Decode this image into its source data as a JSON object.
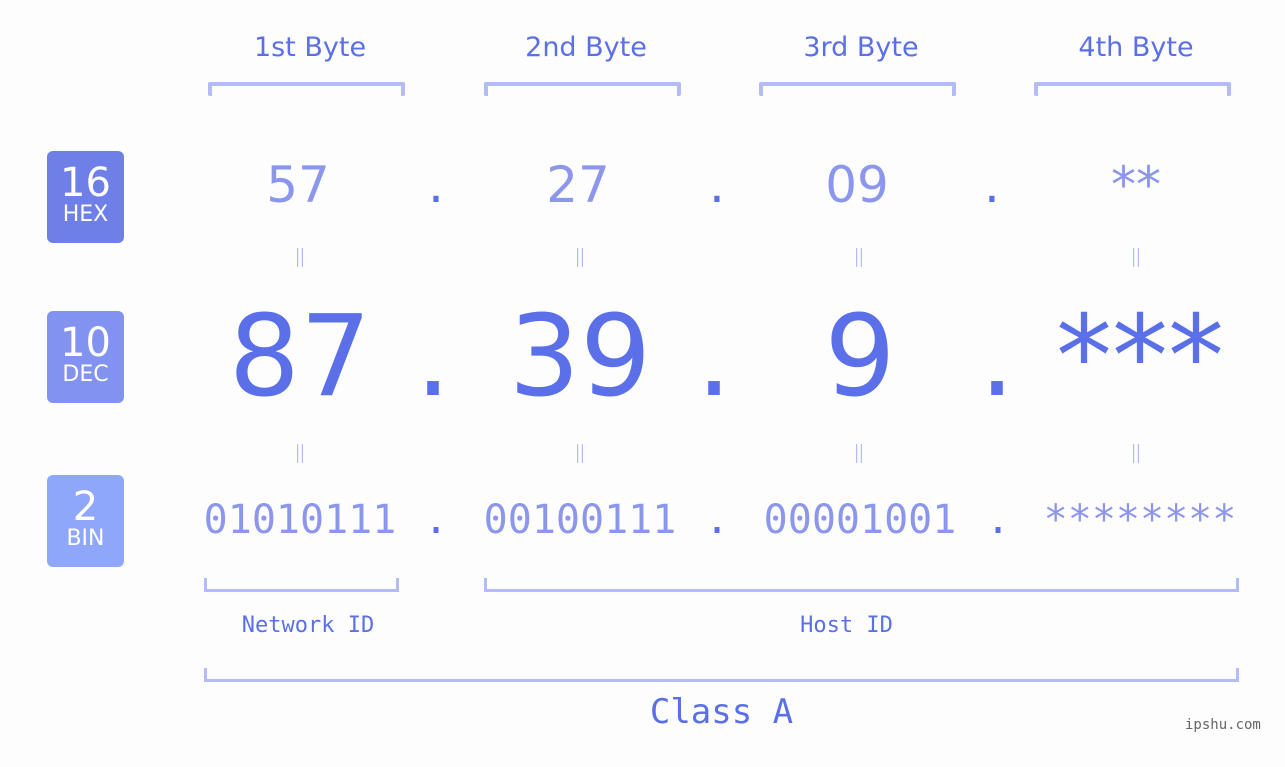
{
  "byte_headers": [
    "1st Byte",
    "2nd Byte",
    "3rd Byte",
    "4th Byte"
  ],
  "bases": [
    {
      "num": "16",
      "label": "HEX",
      "color": "#6e7fe8"
    },
    {
      "num": "10",
      "label": "DEC",
      "color": "#8292f1"
    },
    {
      "num": "2",
      "label": "BIN",
      "color": "#8fa7fb"
    }
  ],
  "hex": [
    "57",
    "27",
    "09",
    "**"
  ],
  "dec": [
    "87",
    "39",
    "9",
    "***"
  ],
  "bin": [
    "01010111",
    "00100111",
    "00001001",
    "********"
  ],
  "separator": ".",
  "equals": "=",
  "network_label": "Network ID",
  "host_label": "Host ID",
  "class_label": "Class A",
  "watermark": "ipshu.com",
  "colors": {
    "primary": "#5a6fe8",
    "light": "#8b96ec",
    "bracket": "#b3bcf6"
  }
}
